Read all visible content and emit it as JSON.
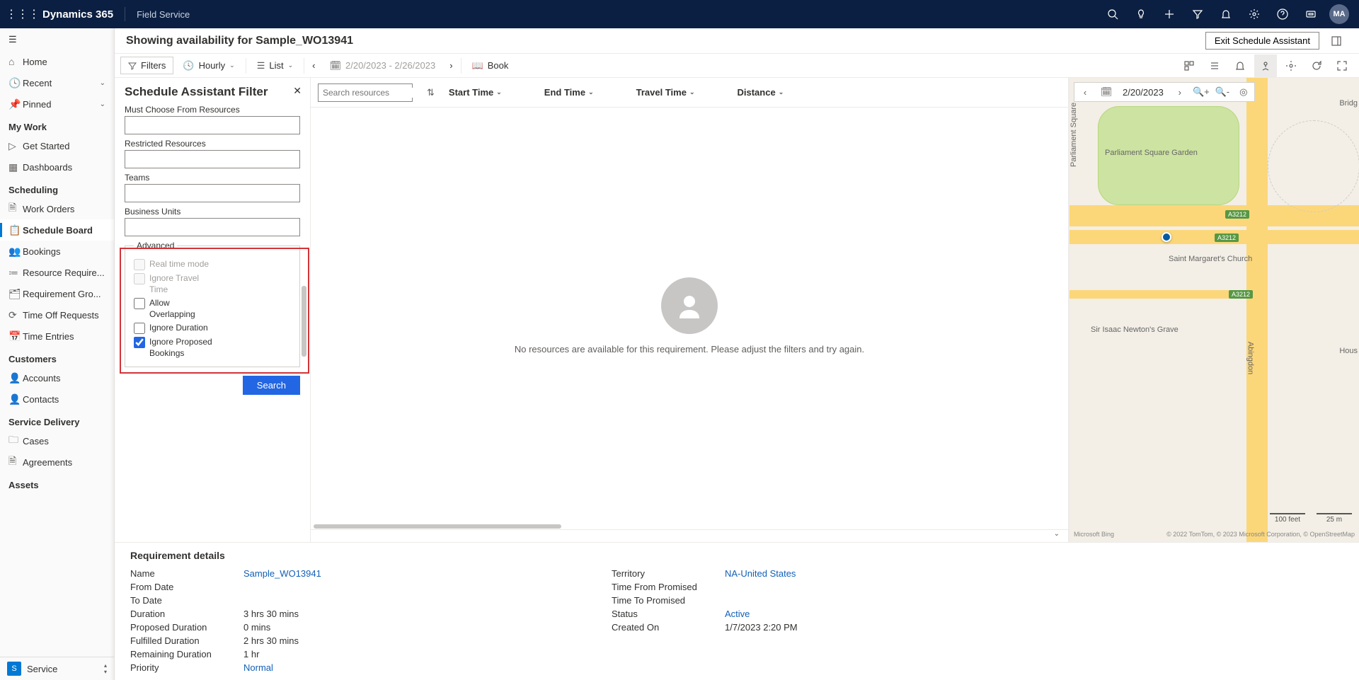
{
  "topbar": {
    "brand": "Dynamics 365",
    "module": "Field Service",
    "avatar_initials": "MA"
  },
  "sidebar": {
    "quick": [
      {
        "label": "Home",
        "icon": "⌂"
      },
      {
        "label": "Recent",
        "icon": "🕓",
        "chev": true
      },
      {
        "label": "Pinned",
        "icon": "📌",
        "chev": true
      }
    ],
    "sections": [
      {
        "title": "My Work",
        "items": [
          {
            "label": "Get Started",
            "icon": "▷"
          },
          {
            "label": "Dashboards",
            "icon": "▦"
          }
        ]
      },
      {
        "title": "Scheduling",
        "items": [
          {
            "label": "Work Orders",
            "icon": "🗎"
          },
          {
            "label": "Schedule Board",
            "icon": "📋",
            "active": true
          },
          {
            "label": "Bookings",
            "icon": "👥"
          },
          {
            "label": "Resource Require...",
            "icon": "≔"
          },
          {
            "label": "Requirement Gro...",
            "icon": "🗂"
          },
          {
            "label": "Time Off Requests",
            "icon": "⟳"
          },
          {
            "label": "Time Entries",
            "icon": "📅"
          }
        ]
      },
      {
        "title": "Customers",
        "items": [
          {
            "label": "Accounts",
            "icon": "👤"
          },
          {
            "label": "Contacts",
            "icon": "👤"
          }
        ]
      },
      {
        "title": "Service Delivery",
        "items": [
          {
            "label": "Cases",
            "icon": "🗀"
          },
          {
            "label": "Agreements",
            "icon": "🗎"
          }
        ]
      },
      {
        "title": "Assets",
        "items": []
      }
    ],
    "footer": {
      "initial": "S",
      "label": "Service"
    }
  },
  "header": {
    "title": "Showing availability for Sample_WO13941",
    "exit_button": "Exit Schedule Assistant"
  },
  "toolbar": {
    "filters": "Filters",
    "hourly": "Hourly",
    "list": "List",
    "date_range": "2/20/2023 - 2/26/2023",
    "book": "Book"
  },
  "filter": {
    "title": "Schedule Assistant Filter",
    "labels": {
      "must_choose": "Must Choose From Resources",
      "restricted": "Restricted Resources",
      "teams": "Teams",
      "business_units": "Business Units"
    },
    "advanced": {
      "legend": "Advanced",
      "real_time": "Real time mode",
      "ignore_travel": "Ignore Travel Time",
      "allow_overlap": "Allow Overlapping",
      "ignore_duration": "Ignore Duration",
      "ignore_proposed": "Ignore Proposed Bookings"
    },
    "search_btn": "Search"
  },
  "results": {
    "search_placeholder": "Search resources",
    "cols": {
      "start": "Start Time",
      "end": "End Time",
      "travel": "Travel Time",
      "distance": "Distance"
    },
    "empty_msg": "No resources are available for this requirement. Please adjust the filters and try again."
  },
  "map": {
    "date": "2/20/2023",
    "labels": {
      "park": "Parliament Square Garden",
      "church": "Saint Margaret's Church",
      "newton": "Sir Isaac Newton's Grave",
      "bridge": "Bridg",
      "hous": "Hous",
      "parl_sq": "Parliament Square",
      "abing": "Abingdon"
    },
    "badge": "A3212",
    "scale": {
      "imperial": "100 feet",
      "metric": "25 m"
    },
    "attr": "Microsoft Bing",
    "attr2": "© 2022 TomTom, © 2023 Microsoft Corporation, © OpenStreetMap"
  },
  "requirement": {
    "title": "Requirement details",
    "left": {
      "name_lbl": "Name",
      "name_val": "Sample_WO13941",
      "from_lbl": "From Date",
      "from_val": "",
      "to_lbl": "To Date",
      "to_val": "",
      "dur_lbl": "Duration",
      "dur_val": "3 hrs 30 mins",
      "prop_lbl": "Proposed Duration",
      "prop_val": "0 mins",
      "ful_lbl": "Fulfilled Duration",
      "ful_val": "2 hrs 30 mins",
      "rem_lbl": "Remaining Duration",
      "rem_val": "1 hr",
      "pri_lbl": "Priority",
      "pri_val": "Normal"
    },
    "right": {
      "terr_lbl": "Territory",
      "terr_val": "NA-United States",
      "tfp_lbl": "Time From Promised",
      "tfp_val": "",
      "ttp_lbl": "Time To Promised",
      "ttp_val": "",
      "stat_lbl": "Status",
      "stat_val": "Active",
      "cre_lbl": "Created On",
      "cre_val": "1/7/2023 2:20 PM"
    }
  }
}
